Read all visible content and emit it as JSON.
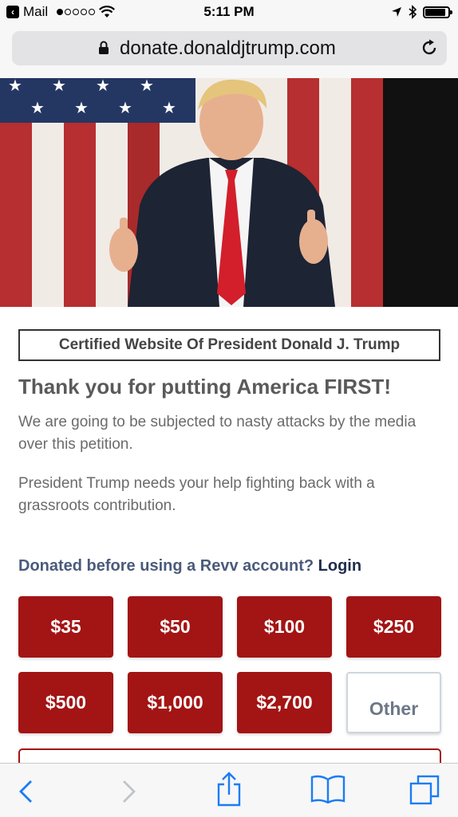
{
  "status_bar": {
    "back_app": "Mail",
    "signal_dots": 5,
    "signal_filled": 1,
    "time": "5:11 PM",
    "battery_level": 0.9,
    "icons": [
      "wifi-icon",
      "location-arrow-icon",
      "bluetooth-icon",
      "battery-icon"
    ]
  },
  "browser": {
    "url": "donate.donaldjtrump.com",
    "icons": [
      "lock-icon",
      "reload-icon"
    ]
  },
  "page": {
    "certified": "Certified Website Of President Donald J. Trump",
    "headline": "Thank you for putting America FIRST!",
    "paragraph1": "We are going to be subjected to nasty attacks by the media over this petition.",
    "paragraph2": "President Trump needs your help fighting back with a grassroots contribution.",
    "donated_prompt": "Donated before using a Revv account?",
    "login_label": "Login",
    "amounts": [
      "$35",
      "$50",
      "$100",
      "$250",
      "$500",
      "$1,000",
      "$2,700"
    ],
    "other_label": "Other",
    "accent_color": "#a31414"
  },
  "toolbar": {
    "icons": [
      "back-chevron-icon",
      "forward-chevron-icon",
      "share-icon",
      "bookmarks-icon",
      "tabs-icon"
    ]
  }
}
